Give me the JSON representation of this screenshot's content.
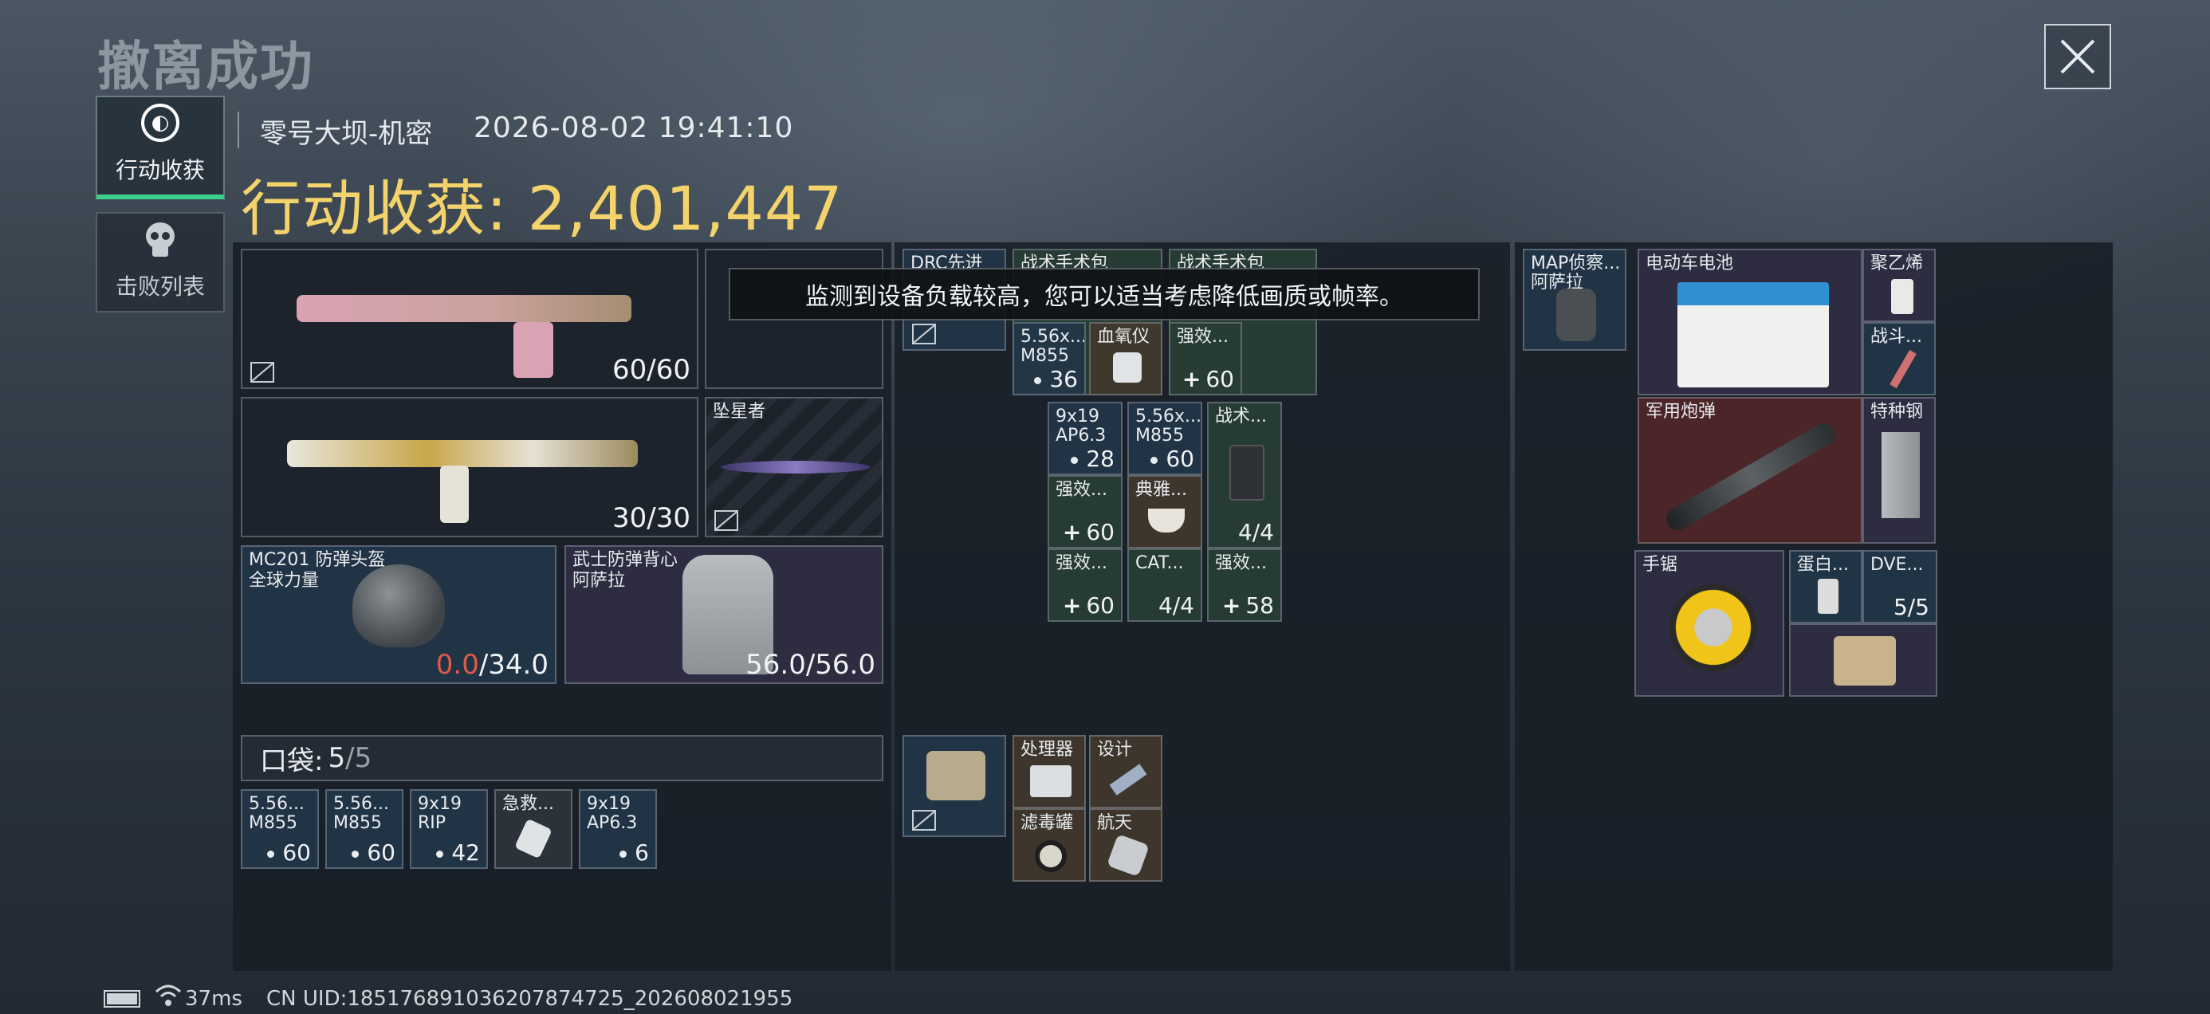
{
  "header": {
    "title": "撤离成功",
    "map_name": "零号大坝-机密",
    "timestamp": "2026-08-02 19:41:10",
    "earnings_label": "行动收获: 2,401,447"
  },
  "tabs": [
    {
      "label": "行动收获",
      "icon": "loot-icon",
      "active": true
    },
    {
      "label": "击败列表",
      "icon": "skull-icon",
      "active": false
    }
  ],
  "toast": "监测到设备负载较高，您可以适当考虑降低画质或帧率。",
  "equipment": {
    "primary_weapon": {
      "count": "60/60"
    },
    "secondary_weapon": {
      "count": "30/30"
    },
    "melee": {
      "name": "坠星者"
    },
    "helmet": {
      "name": "MC201 防弹头盔",
      "sub": "全球力量",
      "durability_current": "0.0",
      "durability_max": "/34.0"
    },
    "armor": {
      "name": "武士防弹背心",
      "sub": "阿萨拉",
      "durability": "56.0/56.0"
    }
  },
  "pockets": {
    "label": "口袋: ",
    "count_current": "5",
    "count_max": "/5",
    "items": [
      {
        "name": "5.56...",
        "sub": "M855",
        "count": "60"
      },
      {
        "name": "5.56...",
        "sub": "M855",
        "count": "60"
      },
      {
        "name": "9x19",
        "sub": "RIP",
        "count": "42"
      },
      {
        "name": "急救...",
        "sub": "",
        "count": ""
      },
      {
        "name": "9x19",
        "sub": "AP6.3",
        "count": "6"
      }
    ]
  },
  "chest_rig": {
    "name": "DRC先进",
    "items": [
      {
        "name": "战术手术包",
        "count": ""
      },
      {
        "name": "战术手术包",
        "count": ""
      },
      {
        "name": "5.56x...",
        "sub": "M855",
        "count": "36"
      },
      {
        "name": "血氧仪",
        "count": ""
      },
      {
        "name": "强效...",
        "count": "60"
      },
      {
        "name": "9x19",
        "sub": "AP6.3",
        "count": "28"
      },
      {
        "name": "5.56x...",
        "sub": "M855",
        "count": "60"
      },
      {
        "name": "战术...",
        "count": "4/4"
      },
      {
        "name": "强效...",
        "count": "60"
      },
      {
        "name": "典雅...",
        "count": ""
      },
      {
        "name": "强效...",
        "count": "60"
      },
      {
        "name": "CAT...",
        "count": "4/4"
      },
      {
        "name": "强效...",
        "count": "58"
      }
    ]
  },
  "case": {
    "items": [
      {
        "name": "处理器"
      },
      {
        "name": "设计"
      },
      {
        "name": "滤毒罐"
      },
      {
        "name": "航天"
      }
    ]
  },
  "backpack": {
    "name": "MAP侦察...",
    "sub": "阿萨拉",
    "items": [
      {
        "name": "电动车电池"
      },
      {
        "name": "聚乙烯"
      },
      {
        "name": "战斗..."
      },
      {
        "name": "军用炮弹"
      },
      {
        "name": "特种钢"
      },
      {
        "name": "手锯"
      },
      {
        "name": "蛋白..."
      },
      {
        "name": "DVE...",
        "count": "5/5"
      }
    ]
  },
  "status_bar": {
    "ping": "37ms",
    "uid": "CN UID:1851768910362078747​25_202608021955"
  },
  "colors": {
    "accent": "#f4d36a",
    "active_tab": "#3ad08a",
    "durability_zero": "#e05a4a"
  }
}
